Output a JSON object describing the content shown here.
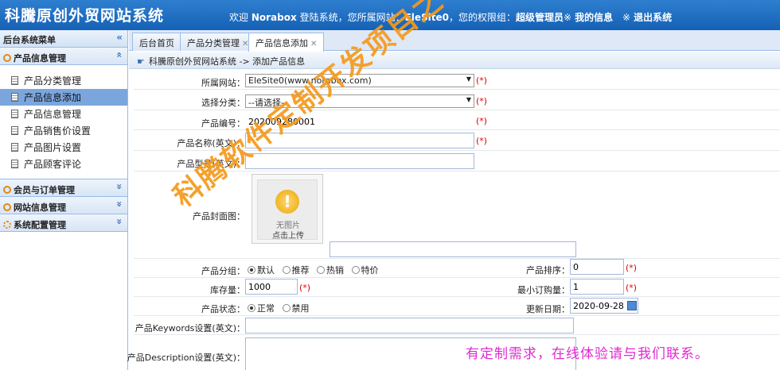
{
  "header": {
    "brand": "科騰原创外贸网站系统",
    "welcome_prefix": "欢迎",
    "username": "Norabox",
    "welcome_mid": "登陆系统，您所属网站：",
    "site": "EleSite0",
    "role_prefix": "，您的权限组：",
    "role": "超级管理员",
    "my_info": "我的信息",
    "logout": "退出系统",
    "link_glyph": "※"
  },
  "sidebar": {
    "title": "后台系统菜单",
    "groups": [
      {
        "label": "产品信息管理",
        "expanded": true
      },
      {
        "label": "会员与订单管理",
        "expanded": false
      },
      {
        "label": "网站信息管理",
        "expanded": false
      },
      {
        "label": "系统配置管理",
        "expanded": false
      }
    ],
    "items": [
      {
        "label": "产品分类管理",
        "active": false
      },
      {
        "label": "产品信息添加",
        "active": true
      },
      {
        "label": "产品信息管理",
        "active": false
      },
      {
        "label": "产品销售价设置",
        "active": false
      },
      {
        "label": "产品图片设置",
        "active": false
      },
      {
        "label": "产品顾客评论",
        "active": false
      }
    ],
    "collapse_glyph": "«",
    "expand_glyph": "»"
  },
  "tabs": [
    {
      "label": "后台首页",
      "closable": false
    },
    {
      "label": "产品分类管理",
      "closable": true
    },
    {
      "label": "产品信息添加",
      "closable": true,
      "active": true
    }
  ],
  "breadcrumb": "科騰原创外贸网站系统 -> 添加产品信息",
  "form": {
    "site_label": "所属网站：",
    "site_value": "EleSite0(www.norabox.com)",
    "category_label": "选择分类：",
    "category_value": "--请选择--",
    "code_label": "产品编号：",
    "code_value": "202009280001",
    "name_label": "产品名称(英文)：",
    "name_value": "",
    "model_label": "产品型号(英文)：",
    "model_value": "",
    "cover_label": "产品封面图：",
    "cover_text1": "无图片",
    "cover_text2": "点击上传",
    "group_label": "产品分组：",
    "group_options": [
      "默认",
      "推荐",
      "热销",
      "特价"
    ],
    "group_selected": "默认",
    "sort_label": "产品排序：",
    "sort_value": "0",
    "stock_label": "库存量：",
    "stock_value": "1000",
    "min_order_label": "最小订购量：",
    "min_order_value": "1",
    "status_label": "产品状态：",
    "status_options": [
      "正常",
      "禁用"
    ],
    "status_selected": "正常",
    "date_label": "更新日期：",
    "date_value": "2020-09-28",
    "keywords_label": "产品Keywords设置(英文)：",
    "keywords_value": "",
    "description_label": "产品Description设置(英文)：",
    "description_value": "",
    "required_mark": "(*)"
  },
  "watermark": "科腾软件定制开发项目之一",
  "promo": "有定制需求，在线体验请与我们联系。",
  "colors": {
    "header_bg": "#1f6fc4",
    "active_item": "#7aa6dd",
    "watermark": "#f59a1b",
    "promo": "#e02ad0",
    "required": "#dd0000"
  }
}
